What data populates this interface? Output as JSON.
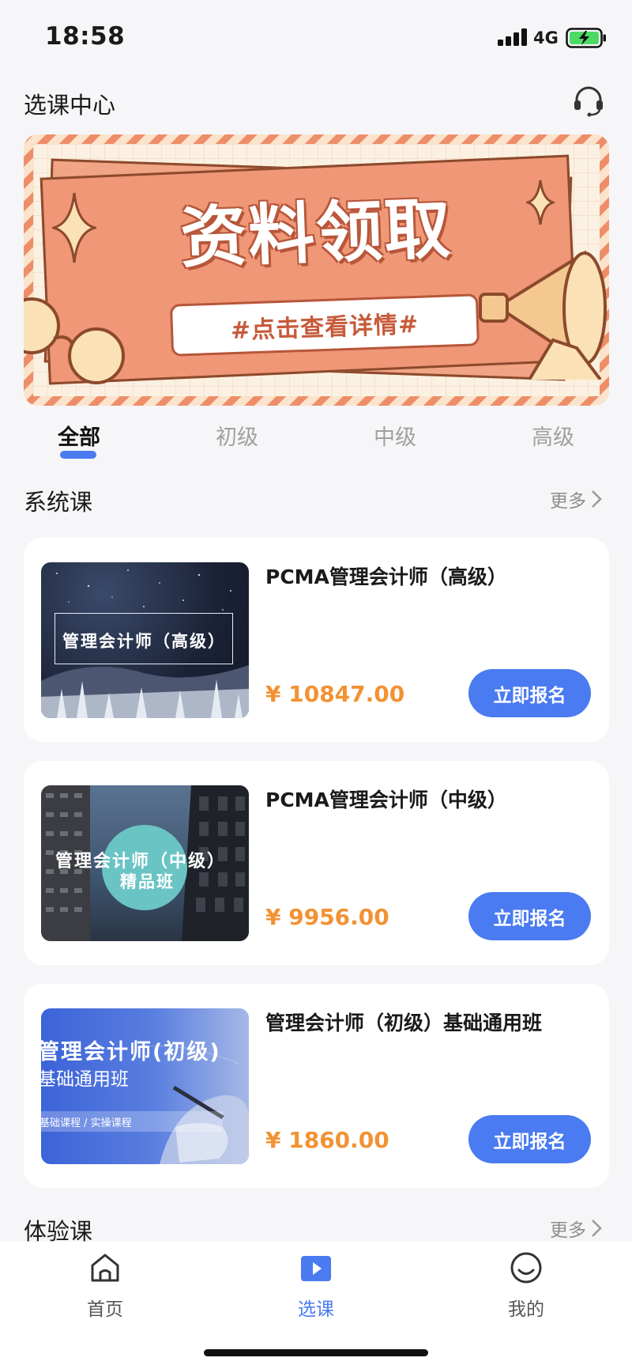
{
  "status_bar": {
    "time": "18:58",
    "network": "4G",
    "icons": [
      "signal-icon",
      "battery-charging-icon"
    ]
  },
  "header": {
    "title": "选课中心",
    "support_icon": "headset-icon"
  },
  "banner": {
    "title": "资料领取",
    "subtitle": "#点击查看详情#",
    "colors": {
      "primary": "#ef9777",
      "stripe": "#ee8e69",
      "background": "#fbf1e2"
    }
  },
  "tabs": [
    {
      "label": "全部",
      "active": true
    },
    {
      "label": "初级",
      "active": false
    },
    {
      "label": "中级",
      "active": false
    },
    {
      "label": "高级",
      "active": false
    }
  ],
  "sections": {
    "system": {
      "title": "系统课",
      "more": "更多"
    },
    "trial": {
      "title": "体验课",
      "more": "更多"
    }
  },
  "courses": [
    {
      "name": "PCMA管理会计师（高级）",
      "price": "¥ 10847.00",
      "button": "立即报名",
      "thumb_text": "管理会计师（高级）"
    },
    {
      "name": "PCMA管理会计师（中级）",
      "price": "¥ 9956.00",
      "button": "立即报名",
      "thumb_text_1": "管理会计师（中级）",
      "thumb_text_2": "精品班"
    },
    {
      "name": "管理会计师（初级）基础通用班",
      "price": "¥ 1860.00",
      "button": "立即报名",
      "thumb_text_1": "管理会计师(初级)",
      "thumb_text_2": "基础通用班",
      "thumb_text_3": "基础课程 / 实操课程"
    }
  ],
  "bottom_nav": [
    {
      "label": "首页",
      "icon": "home-icon",
      "active": false
    },
    {
      "label": "选课",
      "icon": "play-icon",
      "active": true
    },
    {
      "label": "我的",
      "icon": "profile-icon",
      "active": false
    }
  ],
  "colors": {
    "accent": "#4a7bf0",
    "price": "#f29232",
    "background": "#f6f6f8"
  }
}
